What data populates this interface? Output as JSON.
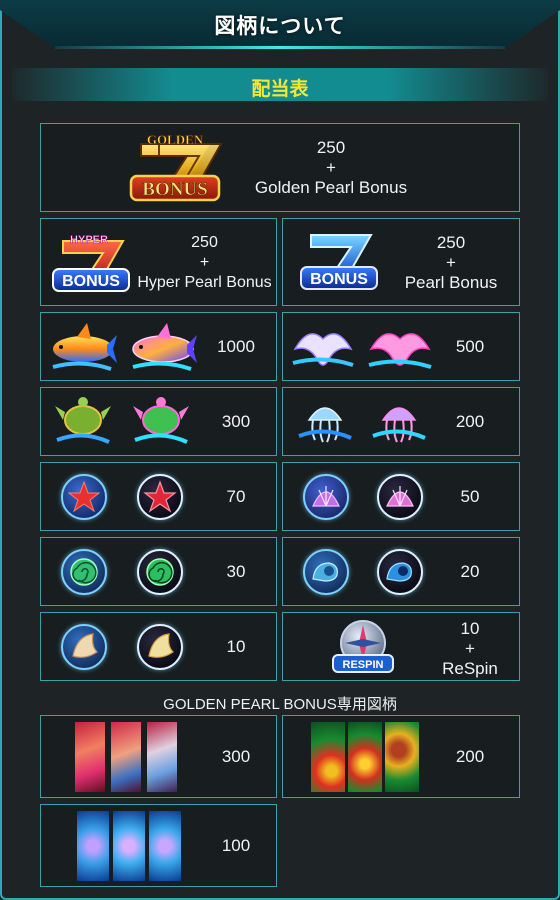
{
  "header": {
    "title": "図柄について"
  },
  "paytable": {
    "title": "配当表"
  },
  "golden_bonus": {
    "logo_top": "GOLDEN",
    "logo_seven": "7",
    "logo_bottom": "BONUS",
    "payout_line1": "250",
    "payout_plus": "+",
    "payout_line3": "Golden Pearl Bonus"
  },
  "hyper_bonus": {
    "logo_top": "HYPER",
    "logo_seven": "7",
    "logo_bottom": "BONUS",
    "payout_line1": "250",
    "payout_plus": "+",
    "payout_line3": "Hyper Pearl Bonus"
  },
  "blue_bonus": {
    "logo_seven": "7",
    "logo_bottom": "BONUS",
    "payout_line1": "250",
    "payout_plus": "+",
    "payout_line3": "Pearl Bonus"
  },
  "symbols": {
    "dolphin": {
      "payout": "1000"
    },
    "manta": {
      "payout": "500"
    },
    "turtle": {
      "payout": "300"
    },
    "jellyfish": {
      "payout": "200"
    },
    "starfish": {
      "payout": "70"
    },
    "scallop": {
      "payout": "50"
    },
    "ammonite": {
      "payout": "30"
    },
    "snail": {
      "payout": "20"
    },
    "conch": {
      "payout": "10"
    },
    "respin": {
      "payout_line1": "10",
      "payout_plus": "+",
      "payout_line3": "ReSpin",
      "badge": "RESPIN"
    }
  },
  "golden_pearl_section": {
    "title": "GOLDEN PEARL BONUS専用図柄",
    "mermaid": {
      "payout": "300"
    },
    "treasure": {
      "payout": "200"
    },
    "dolphins": {
      "payout": "100"
    }
  },
  "colors": {
    "border": "#3f9fa7",
    "accent_yellow": "#f5e634",
    "header_teal": "#138c91"
  }
}
